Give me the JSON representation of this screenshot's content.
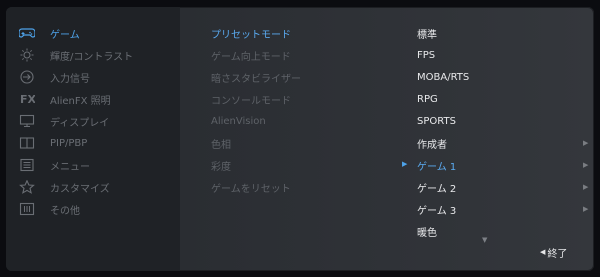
{
  "main_menu": [
    {
      "label": "ゲーム",
      "icon": "gamepad-icon",
      "active": true
    },
    {
      "label": "輝度/コントラスト",
      "icon": "brightness-icon"
    },
    {
      "label": "入力信号",
      "icon": "input-source-icon"
    },
    {
      "label": "AlienFX 照明",
      "icon": "fx-icon"
    },
    {
      "label": "ディスプレイ",
      "icon": "monitor-icon"
    },
    {
      "label": "PIP/PBP",
      "icon": "pip-icon"
    },
    {
      "label": "メニュー",
      "icon": "menu-list-icon"
    },
    {
      "label": "カスタマイズ",
      "icon": "star-icon"
    },
    {
      "label": "その他",
      "icon": "info-icon"
    }
  ],
  "submenu": [
    {
      "label": "プリセットモード",
      "active": true
    },
    {
      "label": "ゲーム向上モード"
    },
    {
      "label": "暗さスタビライザー"
    },
    {
      "label": "コンソールモード"
    },
    {
      "label": "AlienVision"
    },
    {
      "label": "色相"
    },
    {
      "label": "彩度"
    },
    {
      "label": "ゲームをリセット"
    }
  ],
  "options": [
    {
      "label": "標準"
    },
    {
      "label": "FPS"
    },
    {
      "label": "MOBA/RTS"
    },
    {
      "label": "RPG"
    },
    {
      "label": "SPORTS"
    },
    {
      "label": "作成者",
      "has_arrow": true
    },
    {
      "label": "ゲーム 1",
      "selected": true,
      "has_arrow": true
    },
    {
      "label": "ゲーム 2",
      "has_arrow": true
    },
    {
      "label": "ゲーム 3",
      "has_arrow": true
    },
    {
      "label": "暖色"
    }
  ],
  "exit_label": "終了",
  "colors": {
    "accent": "#4ea3ea",
    "inactive_text": "#6a6e74",
    "option_text": "#e8e9eb"
  }
}
